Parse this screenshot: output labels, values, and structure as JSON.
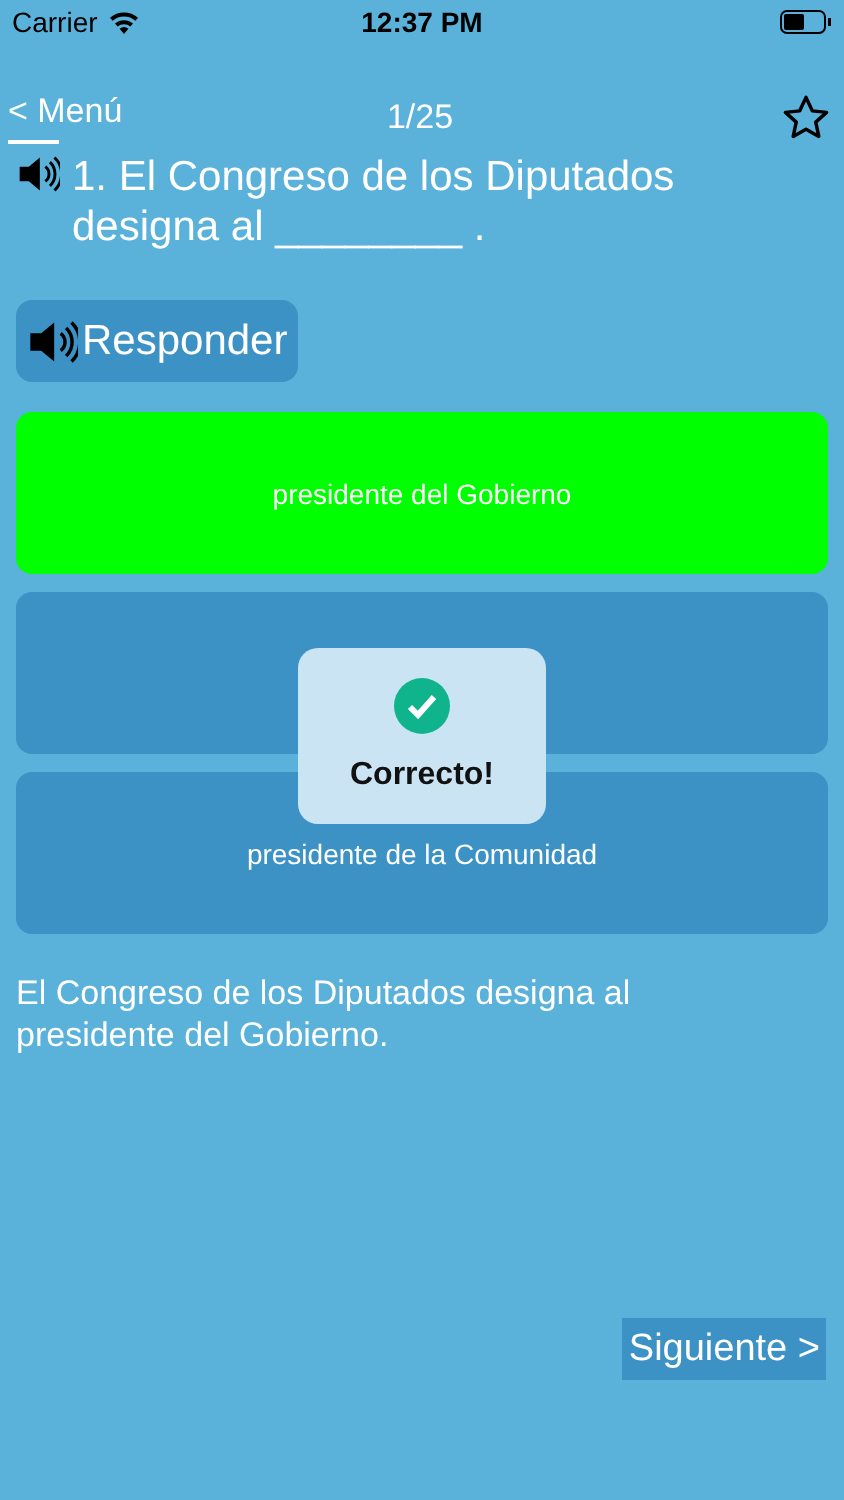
{
  "status_bar": {
    "carrier": "Carrier",
    "time": "12:37 PM"
  },
  "nav": {
    "back": "< Menú",
    "progress": "1/25",
    "favorite": false
  },
  "question": {
    "text": "1. El Congreso de los Diputados designa al ________ ."
  },
  "listen_button": "Responder",
  "answers": [
    {
      "label": "presidente del Gobierno",
      "correct": true
    },
    {
      "correct": false
    },
    {
      "label": "presidente de la Comunidad",
      "correct": false
    }
  ],
  "toast": {
    "message": "Correcto!"
  },
  "explanation": "El Congreso de los Diputados designa al presidente del Gobierno.",
  "next_button": "Siguiente >"
}
